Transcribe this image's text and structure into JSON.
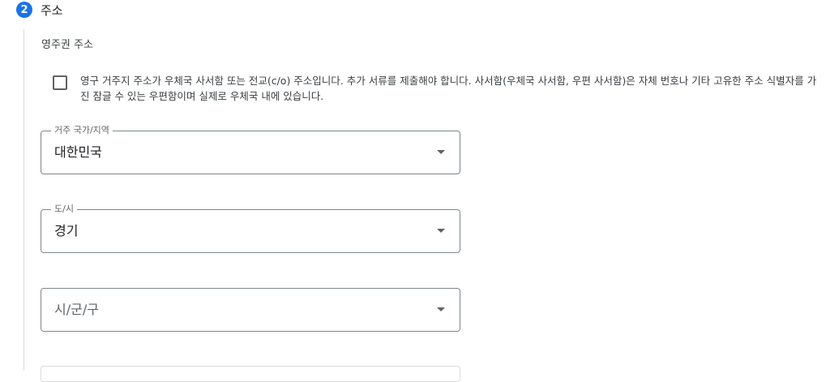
{
  "step": {
    "number": "2",
    "title": "주소"
  },
  "section": {
    "label": "영주권 주소"
  },
  "po_box_checkbox": {
    "checked": false,
    "label": "영구 거주지 주소가 우체국 사서함 또는 전교(c/o) 주소입니다. 추가 서류를 제출해야 합니다. 사서함(우체국 사서함, 우편 사서함)은 자체 번호나 기타 고유한 주소 식별자를 가진 잠글 수 있는 우편함이며 실제로 우체국 내에 있습니다."
  },
  "fields": {
    "country": {
      "label": "거주 국가/지역",
      "value": "대한민국"
    },
    "province": {
      "label": "도/시",
      "value": "경기"
    },
    "city": {
      "placeholder": "시/군/구"
    }
  },
  "colors": {
    "accent": "#1a73e8",
    "field_border": "#80868b",
    "rail": "#dadce0"
  }
}
